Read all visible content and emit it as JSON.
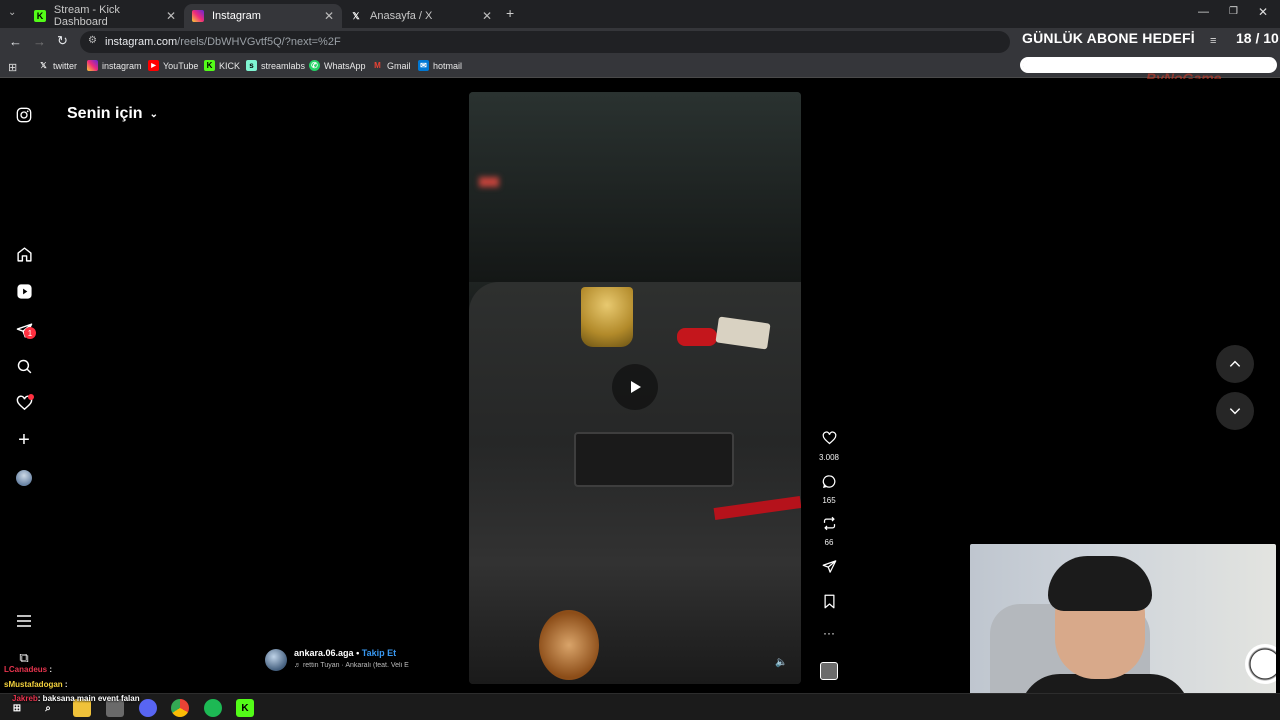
{
  "browser": {
    "tabs": [
      {
        "label": "Stream - Kick Dashboard",
        "icon": "kick-icon",
        "active": false
      },
      {
        "label": "Instagram",
        "icon": "instagram-icon",
        "active": true
      },
      {
        "label": "Anasayfa / X",
        "icon": "x-icon",
        "active": false
      }
    ],
    "url_host": "instagram.com",
    "url_path": "/reels/DbWHVGvtf5Q/?next=%2F",
    "bookmarks": [
      {
        "label": "twitter",
        "icon": "x-icon"
      },
      {
        "label": "instagram",
        "icon": "instagram-icon"
      },
      {
        "label": "YouTube",
        "icon": "youtube-icon"
      },
      {
        "label": "KICK",
        "icon": "kick-icon"
      },
      {
        "label": "streamlabs",
        "icon": "streamlabs-icon"
      },
      {
        "label": "WhatsApp",
        "icon": "whatsapp-icon"
      },
      {
        "label": "Gmail",
        "icon": "gmail-icon"
      },
      {
        "label": "hotmail",
        "icon": "hotmail-icon"
      }
    ]
  },
  "overlay": {
    "goal_title": "GÜNLÜK ABONE HEDEFİ",
    "goal_count": "18 / 10",
    "goal_fraction": 1.0,
    "brand": "ByNoGame"
  },
  "instagram": {
    "feed_title": "Senin için",
    "nav_badge_messages": "1",
    "reel": {
      "likes": "3.008",
      "comments": "165",
      "reposts": "66",
      "author": "ankara.06.aga",
      "separator": "•",
      "follow_label": "Takip Et",
      "audio": "rettin Tuyan · Ankaralı (feat. Veli E"
    }
  },
  "chat": [
    {
      "user": "LCanadeus",
      "text": ":",
      "color": "#e8344e"
    },
    {
      "user": "sMustafadogan",
      "text": ":",
      "color": "#f2d13d"
    },
    {
      "user": "Jakreb",
      "text": ": baksana main event falan",
      "color": "#e8344e"
    }
  ],
  "colors": {
    "accent_blue": "#0095f6",
    "notif_red": "#ff3040",
    "kick_green": "#53fc18"
  }
}
